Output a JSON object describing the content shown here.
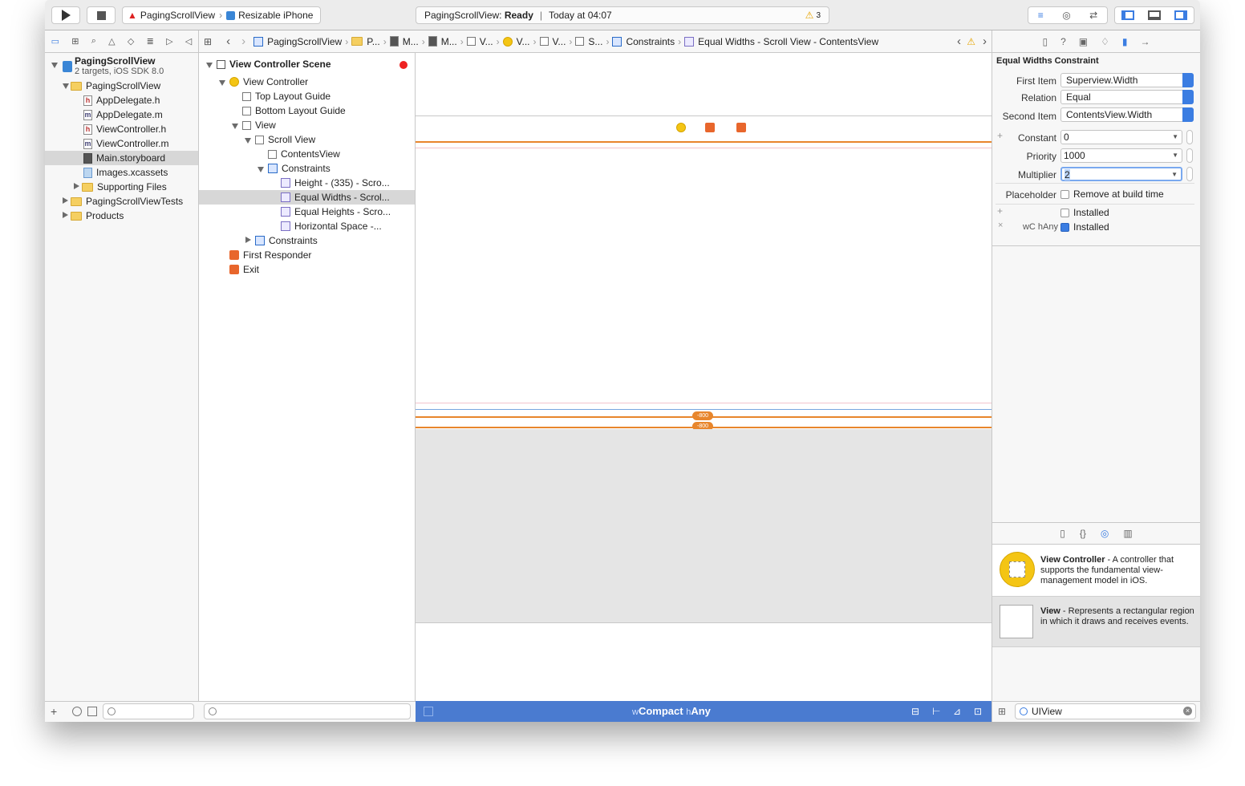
{
  "toolbar": {
    "scheme": "PagingScrollView",
    "device": "Resizable iPhone",
    "status_project": "PagingScrollView:",
    "status_state": "Ready",
    "status_sep": "|",
    "status_time": "Today at 04:07",
    "warning_count": "3"
  },
  "jumpbar": {
    "items": [
      "PagingScrollView",
      "P...",
      "M...",
      "M...",
      "V...",
      "V...",
      "V...",
      "S...",
      "Constraints",
      "Equal Widths - Scroll View - ContentsView"
    ]
  },
  "navigator": {
    "project_name": "PagingScrollView",
    "project_sub": "2 targets, iOS SDK 8.0",
    "group": "PagingScrollView",
    "files": [
      "AppDelegate.h",
      "AppDelegate.m",
      "ViewController.h",
      "ViewController.m",
      "Main.storyboard",
      "Images.xcassets",
      "Supporting Files"
    ],
    "tests": "PagingScrollViewTests",
    "products": "Products"
  },
  "outline": {
    "scene": "View Controller Scene",
    "items": [
      "View Controller",
      "Top Layout Guide",
      "Bottom Layout Guide",
      "View",
      "Scroll View",
      "ContentsView",
      "Constraints",
      "Height - (335) - Scro...",
      "Equal Widths - Scrol...",
      "Equal Heights - Scro...",
      "Horizontal Space -...",
      "Constraints",
      "First Responder",
      "Exit"
    ]
  },
  "canvas": {
    "badge1": "-800",
    "badge2": "-800",
    "size_w_prefix": "w",
    "size_w": "Compact",
    "size_h_prefix": "h",
    "size_h": "Any"
  },
  "inspector": {
    "title": "Equal Widths Constraint",
    "first_item_label": "First Item",
    "first_item": "Superview.Width",
    "relation_label": "Relation",
    "relation": "Equal",
    "second_item_label": "Second Item",
    "second_item": "ContentsView.Width",
    "constant_label": "Constant",
    "constant": "0",
    "priority_label": "Priority",
    "priority": "1000",
    "multiplier_label": "Multiplier",
    "multiplier": "2",
    "placeholder_label": "Placeholder",
    "remove_label": "Remove at build time",
    "installed1": "Installed",
    "size_class": "wC hAny",
    "installed2": "Installed"
  },
  "library": {
    "vc_title": "View Controller",
    "vc_desc": " - A controller that supports the fundamental view-management model in iOS.",
    "view_title": "View",
    "view_desc": " - Represents a rectangular region in which it draws and receives events.",
    "search_value": "UIView"
  },
  "colors": {
    "accent": "#3b7de2",
    "constraint": "#e8862c",
    "bottom_bar": "#4a7bd0"
  }
}
